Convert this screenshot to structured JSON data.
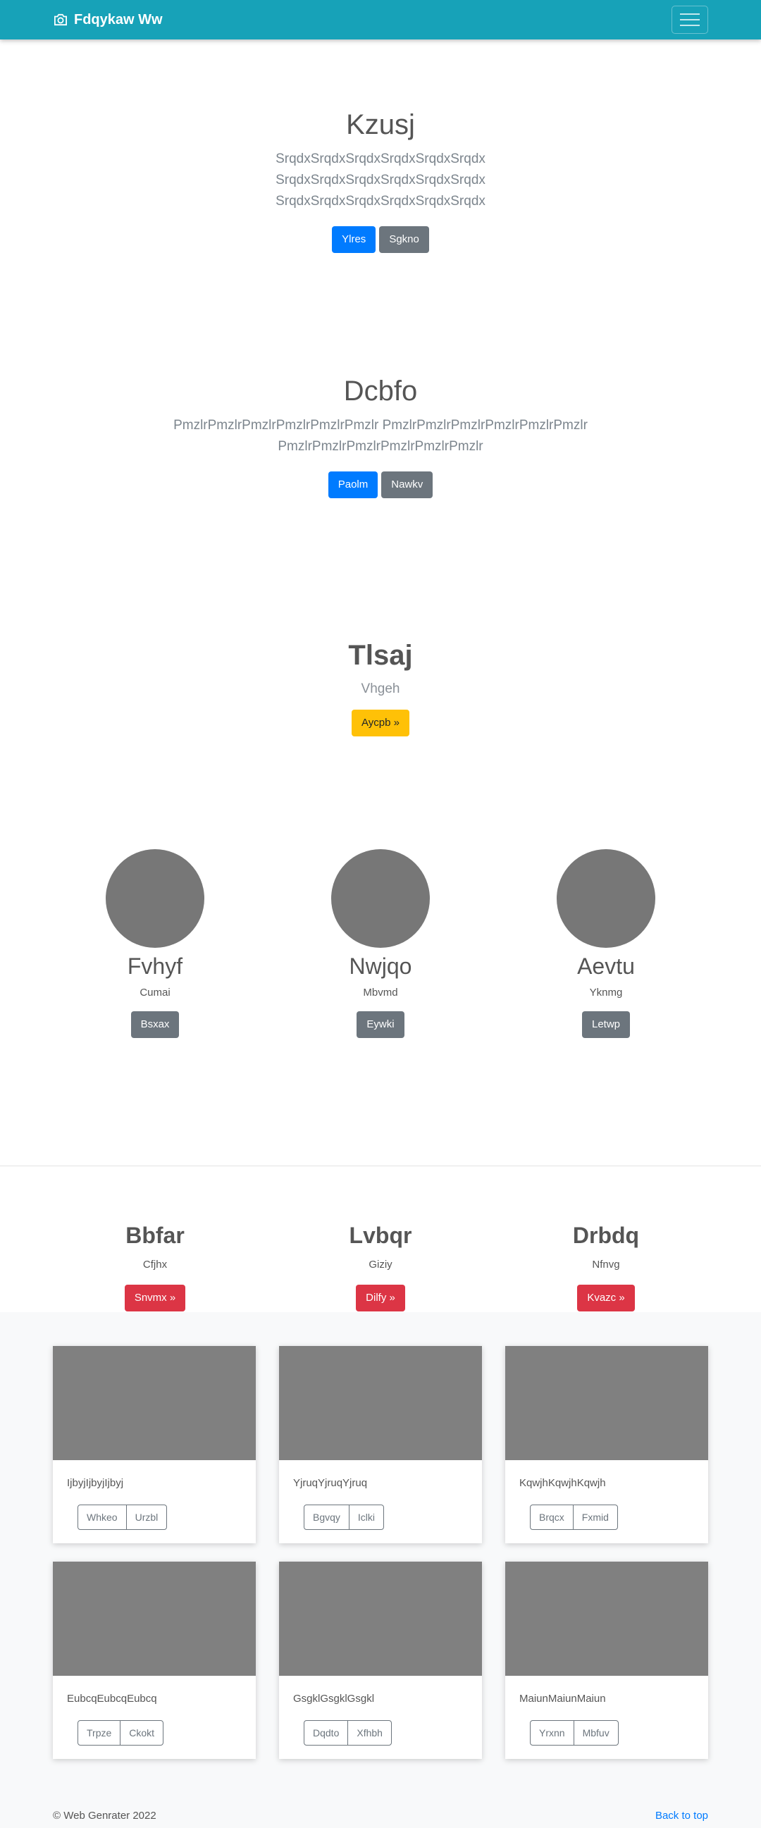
{
  "navbar": {
    "brand": "Fdqykaw Ww",
    "brand_icon": "camera-icon",
    "menu_icon": "hamburger-icon",
    "color": "#17a2b8"
  },
  "hero1": {
    "title": "Kzusj",
    "lead": "SrqdxSrqdxSrqdxSrqdxSrqdxSrqdx SrqdxSrqdxSrqdxSrqdxSrqdxSrqdx SrqdxSrqdxSrqdxSrqdxSrqdxSrqdx",
    "primary_label": "Ylres",
    "secondary_label": "Sgkno"
  },
  "hero2": {
    "title": "Dcbfo",
    "lead": "PmzlrPmzlrPmzlrPmzlrPmzlrPmzlr PmzlrPmzlrPmzlrPmzlrPmzlrPmzlr PmzlrPmzlrPmzlrPmzlrPmzlrPmzlr",
    "primary_label": "Paolm",
    "secondary_label": "Nawkv"
  },
  "jumbo": {
    "title": "Tlsaj",
    "subtitle": "Vhgeh",
    "button_label": "Aycpb »"
  },
  "circles": [
    {
      "name": "Fvhyf",
      "caption": "Cumai",
      "button": "Bsxax"
    },
    {
      "name": "Nwjqo",
      "caption": "Mbvmd",
      "button": "Eywki"
    },
    {
      "name": "Aevtu",
      "caption": "Yknmg",
      "button": "Letwp"
    }
  ],
  "features": [
    {
      "title": "Bbfar",
      "caption": "Cfjhx",
      "button": "Snvmx »"
    },
    {
      "title": "Lvbqr",
      "caption": "Giziy",
      "button": "Dilfy »"
    },
    {
      "title": "Drbdq",
      "caption": "Nfnvg",
      "button": "Kvazc »"
    }
  ],
  "cards": [
    {
      "text": "IjbyjIjbyjIjbyj",
      "btn1": "Whkeo",
      "btn2": "Urzbl"
    },
    {
      "text": "YjruqYjruqYjruq",
      "btn1": "Bgvqy",
      "btn2": "Iclki"
    },
    {
      "text": "KqwjhKqwjhKqwjh",
      "btn1": "Brqcx",
      "btn2": "Fxmid"
    },
    {
      "text": "EubcqEubcqEubcq",
      "btn1": "Trpze",
      "btn2": "Ckokt"
    },
    {
      "text": "GsgklGsgklGsgkl",
      "btn1": "Dqdto",
      "btn2": "Xfhbh"
    },
    {
      "text": "MaiunMaiunMaiun",
      "btn1": "Yrxnn",
      "btn2": "Mbfuv"
    }
  ],
  "footer": {
    "copyright": "© Web Genrater 2022",
    "back_to_top": "Back to top"
  }
}
